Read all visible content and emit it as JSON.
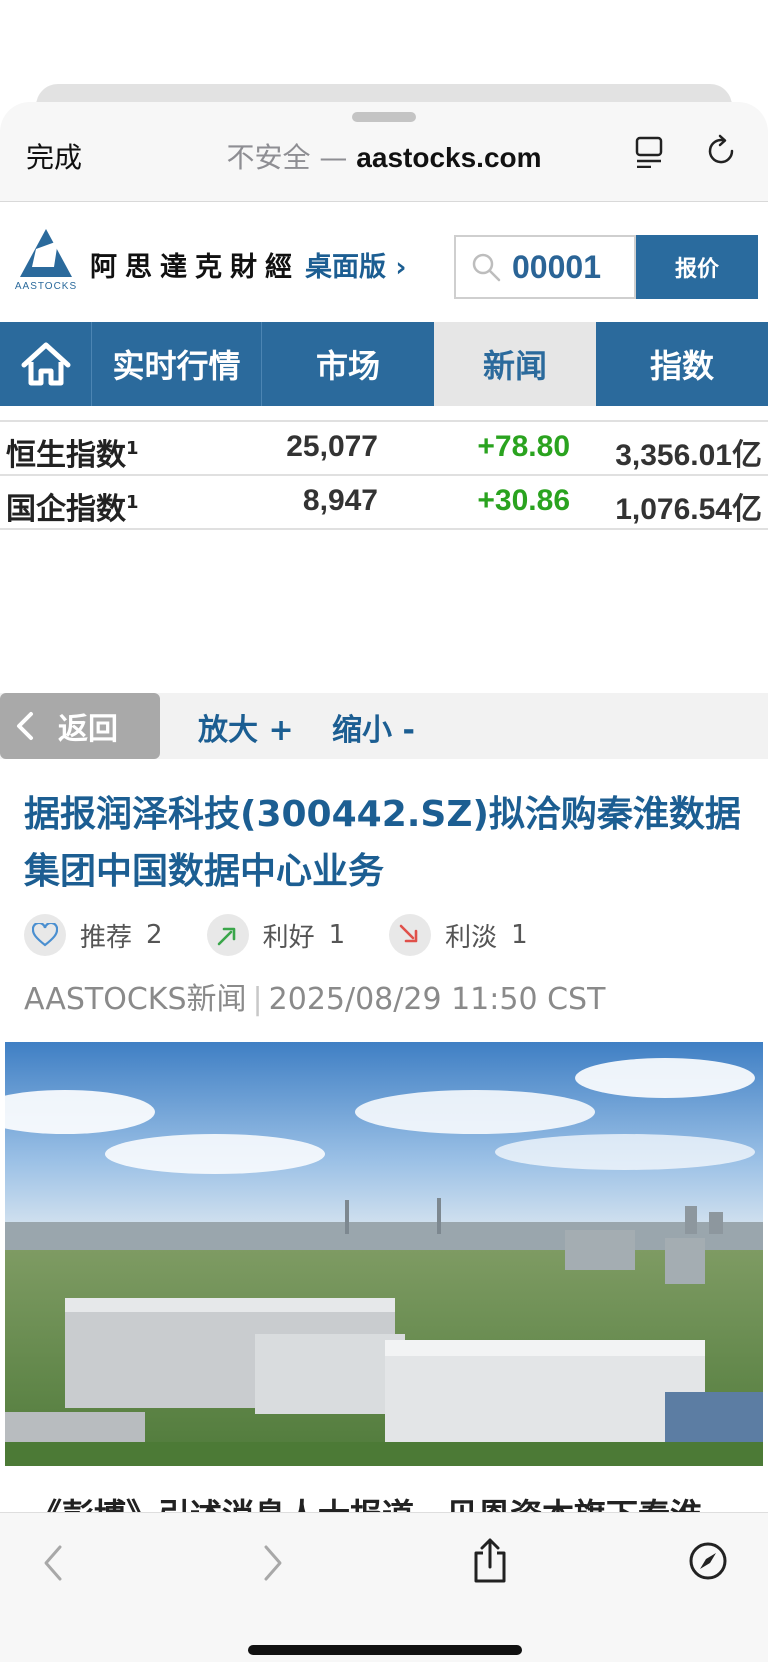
{
  "browser": {
    "done_label": "完成",
    "url_insecure": "不安全 —",
    "url_host": "aastocks.com"
  },
  "site": {
    "logo_text": "AASTOCKS",
    "brand_name": "阿思達克財經",
    "desktop_link": "桌面版 ›",
    "search_value": "00001",
    "quote_button": "报价"
  },
  "nav": {
    "items": [
      {
        "label": "实时行情"
      },
      {
        "label": "市场"
      },
      {
        "label": "新闻"
      },
      {
        "label": "指数"
      }
    ],
    "active": "新闻"
  },
  "indices": [
    {
      "name": "恒生指数",
      "sup": "1",
      "value": "25,077",
      "change": "+78.80",
      "turnover": "3,356.01亿"
    },
    {
      "name": "国企指数",
      "sup": "1",
      "value": "8,947",
      "change": "+30.86",
      "turnover": "1,076.54亿"
    }
  ],
  "toolbar": {
    "back_label": "返回",
    "zoom_in": "放大 +",
    "zoom_out": "缩小 -"
  },
  "article": {
    "headline": "据报润泽科技(300442.SZ)拟洽购秦淮数据集团中国数据中心业务",
    "reactions": [
      {
        "label": "推荐",
        "count": "2",
        "icon": "heart-icon"
      },
      {
        "label": "利好",
        "count": "1",
        "icon": "arrow-up-icon"
      },
      {
        "label": "利淡",
        "count": "1",
        "icon": "arrow-down-icon"
      }
    ],
    "source": "AASTOCKS新闻",
    "separator": "|",
    "datetime": "2025/08/29 11:50 CST",
    "next_line": "《彭博》引述消息人士报道，贝恩资本旗下秦淮"
  },
  "colors": {
    "brand_blue": "#2b6a9c",
    "link_blue": "#1c5e92",
    "gain_green": "#2aa31f"
  }
}
